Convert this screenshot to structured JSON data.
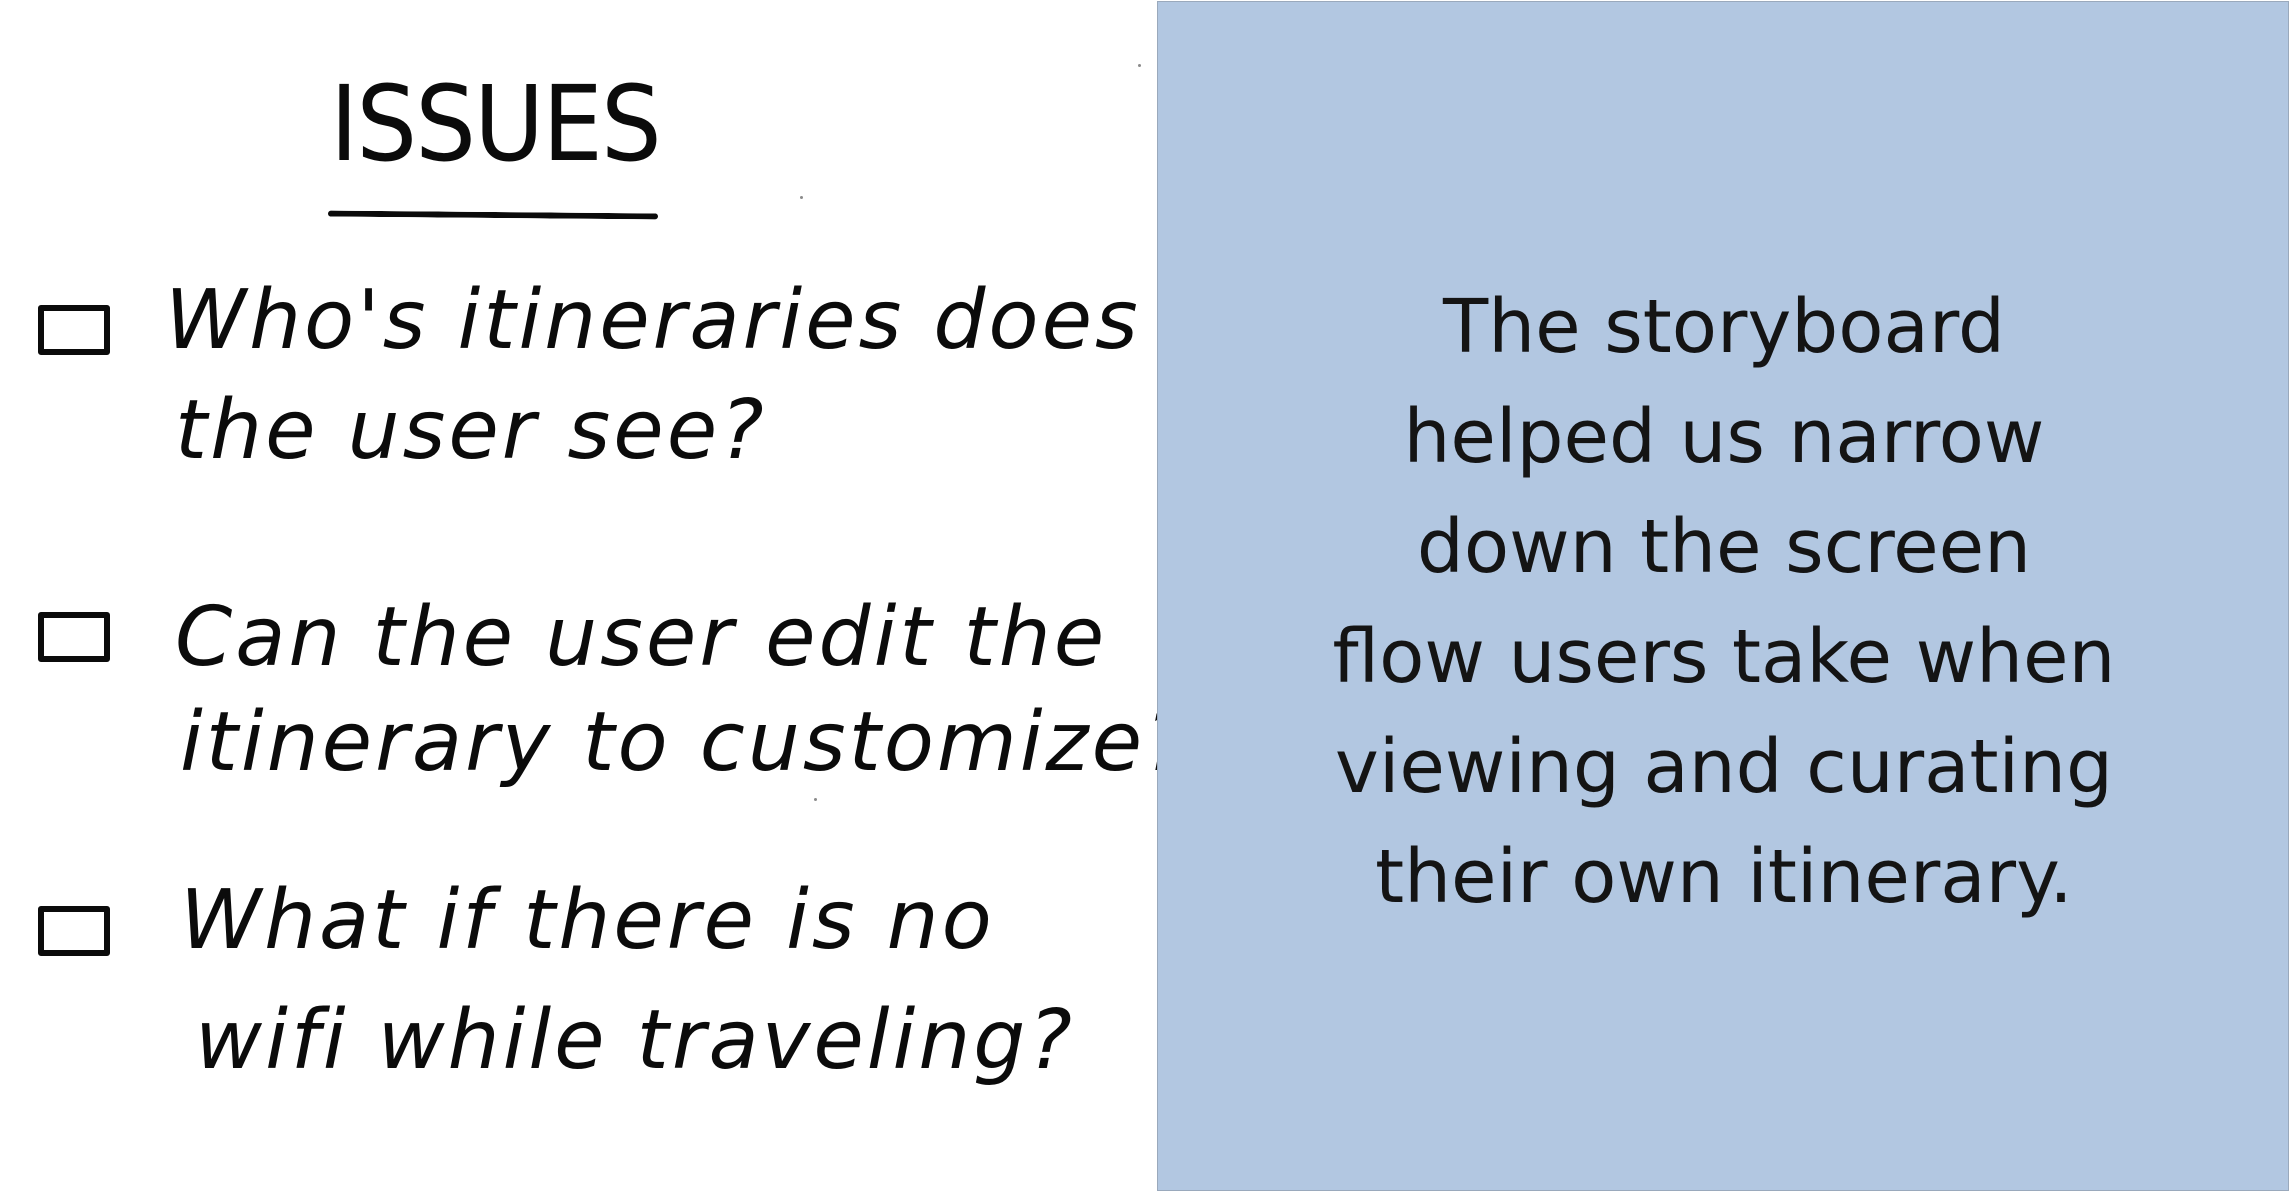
{
  "issues_panel": {
    "title": "ISSUES",
    "items": [
      {
        "lines": [
          "Who's itineraries does",
          "the user see?"
        ]
      },
      {
        "lines": [
          "Can the user edit the",
          "itinerary to customize?"
        ]
      },
      {
        "lines": [
          "What if there is no",
          "wifi while traveling?"
        ]
      }
    ]
  },
  "summary_panel": {
    "lines": [
      "The storyboard",
      "helped us narrow",
      "down the screen",
      "flow users take when",
      "viewing and curating",
      "their own itinerary."
    ],
    "background_color": "#b2c7e1"
  }
}
